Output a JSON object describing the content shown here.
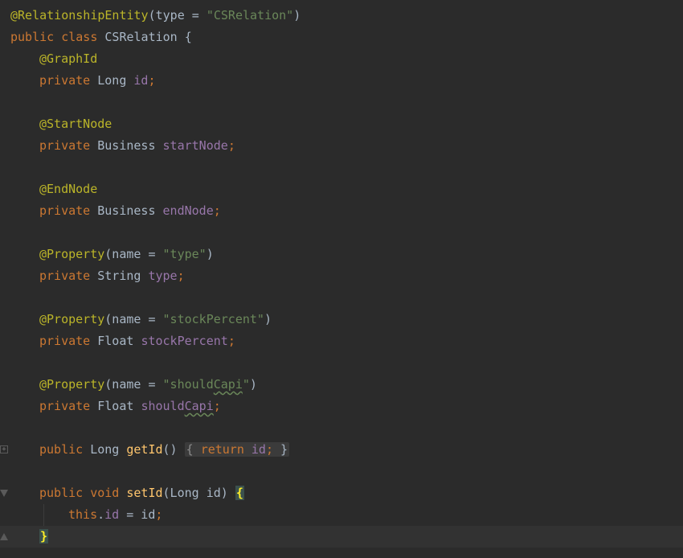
{
  "editor": {
    "language": "java",
    "lines": [
      {
        "tokens": [
          {
            "cls": "ann",
            "text": "@RelationshipEntity"
          },
          {
            "cls": "plain",
            "text": "(type = "
          },
          {
            "cls": "str",
            "text": "\"CSRelation\""
          },
          {
            "cls": "plain",
            "text": ")"
          }
        ]
      },
      {
        "tokens": [
          {
            "cls": "kw",
            "text": "public class "
          },
          {
            "cls": "plain",
            "text": "CSRelation {"
          }
        ]
      },
      {
        "tokens": [
          {
            "cls": "ann",
            "text": "@GraphId"
          }
        ]
      },
      {
        "tokens": [
          {
            "cls": "kw",
            "text": "private "
          },
          {
            "cls": "plain",
            "text": "Long "
          },
          {
            "cls": "field",
            "text": "id"
          },
          {
            "cls": "punc",
            "text": ";"
          }
        ]
      },
      {
        "tokens": []
      },
      {
        "tokens": [
          {
            "cls": "ann",
            "text": "@StartNode"
          }
        ]
      },
      {
        "tokens": [
          {
            "cls": "kw",
            "text": "private "
          },
          {
            "cls": "plain",
            "text": "Business "
          },
          {
            "cls": "field",
            "text": "startNode"
          },
          {
            "cls": "punc",
            "text": ";"
          }
        ]
      },
      {
        "tokens": []
      },
      {
        "tokens": [
          {
            "cls": "ann",
            "text": "@EndNode"
          }
        ]
      },
      {
        "tokens": [
          {
            "cls": "kw",
            "text": "private "
          },
          {
            "cls": "plain",
            "text": "Business "
          },
          {
            "cls": "field",
            "text": "endNode"
          },
          {
            "cls": "punc",
            "text": ";"
          }
        ]
      },
      {
        "tokens": []
      },
      {
        "tokens": [
          {
            "cls": "ann",
            "text": "@Property"
          },
          {
            "cls": "plain",
            "text": "(name = "
          },
          {
            "cls": "str",
            "text": "\"type\""
          },
          {
            "cls": "plain",
            "text": ")"
          }
        ]
      },
      {
        "tokens": [
          {
            "cls": "kw",
            "text": "private "
          },
          {
            "cls": "plain",
            "text": "String "
          },
          {
            "cls": "field",
            "text": "type"
          },
          {
            "cls": "punc",
            "text": ";"
          }
        ]
      },
      {
        "tokens": []
      },
      {
        "tokens": [
          {
            "cls": "ann",
            "text": "@Property"
          },
          {
            "cls": "plain",
            "text": "(name = "
          },
          {
            "cls": "str",
            "text": "\"stockPercent\""
          },
          {
            "cls": "plain",
            "text": ")"
          }
        ]
      },
      {
        "tokens": [
          {
            "cls": "kw",
            "text": "private "
          },
          {
            "cls": "plain",
            "text": "Float "
          },
          {
            "cls": "field",
            "text": "stockPercent"
          },
          {
            "cls": "punc",
            "text": ";"
          }
        ]
      },
      {
        "tokens": []
      },
      {
        "tokens": [
          {
            "cls": "ann",
            "text": "@Property"
          },
          {
            "cls": "plain",
            "text": "(name = "
          },
          {
            "cls": "str",
            "text": "\"should"
          },
          {
            "cls": "str typo",
            "text": "Capi"
          },
          {
            "cls": "str",
            "text": "\""
          },
          {
            "cls": "plain",
            "text": ")"
          }
        ]
      },
      {
        "tokens": [
          {
            "cls": "kw",
            "text": "private "
          },
          {
            "cls": "plain",
            "text": "Float "
          },
          {
            "cls": "field",
            "text": "should"
          },
          {
            "cls": "field typo",
            "text": "Capi"
          },
          {
            "cls": "punc",
            "text": ";"
          }
        ]
      },
      {
        "tokens": []
      },
      {
        "tokens": [
          {
            "cls": "kw",
            "text": "public "
          },
          {
            "cls": "plain",
            "text": "Long "
          },
          {
            "cls": "fn",
            "text": "getId"
          },
          {
            "cls": "plain",
            "text": "() "
          },
          {
            "cls": "fold-body",
            "text": "{ ",
            "inner": [
              {
                "cls": "kw",
                "text": "return "
              },
              {
                "cls": "field",
                "text": "id"
              },
              {
                "cls": "punc",
                "text": "; "
              },
              {
                "cls": "plain",
                "text": "}"
              }
            ]
          }
        ]
      },
      {
        "tokens": []
      },
      {
        "tokens": [
          {
            "cls": "kw",
            "text": "public void "
          },
          {
            "cls": "fn",
            "text": "setId"
          },
          {
            "cls": "plain",
            "text": "(Long id) "
          },
          {
            "cls": "brace-match",
            "text": "{"
          }
        ]
      },
      {
        "tokens": [
          {
            "cls": "kw",
            "text": "this"
          },
          {
            "cls": "plain",
            "text": "."
          },
          {
            "cls": "field",
            "text": "id "
          },
          {
            "cls": "plain",
            "text": "= id"
          },
          {
            "cls": "punc",
            "text": ";"
          }
        ]
      },
      {
        "tokens": [
          {
            "cls": "brace-match",
            "text": "}"
          }
        ]
      }
    ]
  },
  "colors": {
    "background": "#2b2b2b",
    "current_line": "#323232",
    "annotation": "#bbb529",
    "keyword": "#cc7832",
    "string": "#6a8759",
    "field": "#9876aa",
    "method": "#ffc66d",
    "text": "#a9b7c6"
  },
  "icons": {
    "fold_collapsed": "plus-box-icon",
    "fold_open": "fold-open-icon",
    "fold_end": "fold-end-icon"
  }
}
